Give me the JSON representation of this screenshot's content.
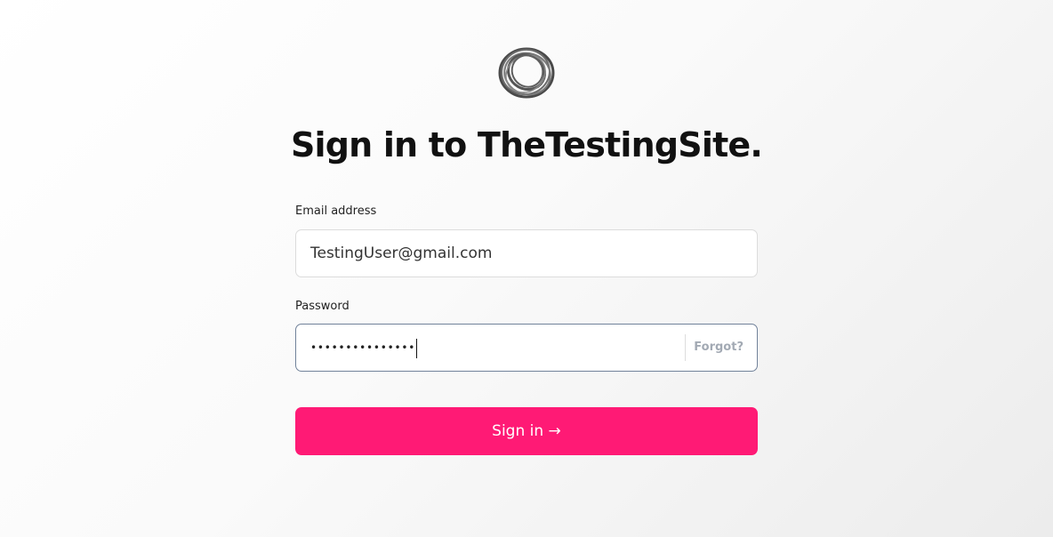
{
  "header": {
    "logo_icon": "circle-scribble-logo",
    "title": "Sign in to TheTestingSite."
  },
  "form": {
    "email": {
      "label": "Email address",
      "value": "TestingUser@gmail.com"
    },
    "password": {
      "label": "Password",
      "masked_value": "•••••••••••••••",
      "forgot_label": "Forgot?"
    },
    "submit_label": "Sign in →"
  },
  "colors": {
    "accent": "#ff1a75",
    "focus_border": "#71829a",
    "muted_link": "#a3aab4"
  }
}
